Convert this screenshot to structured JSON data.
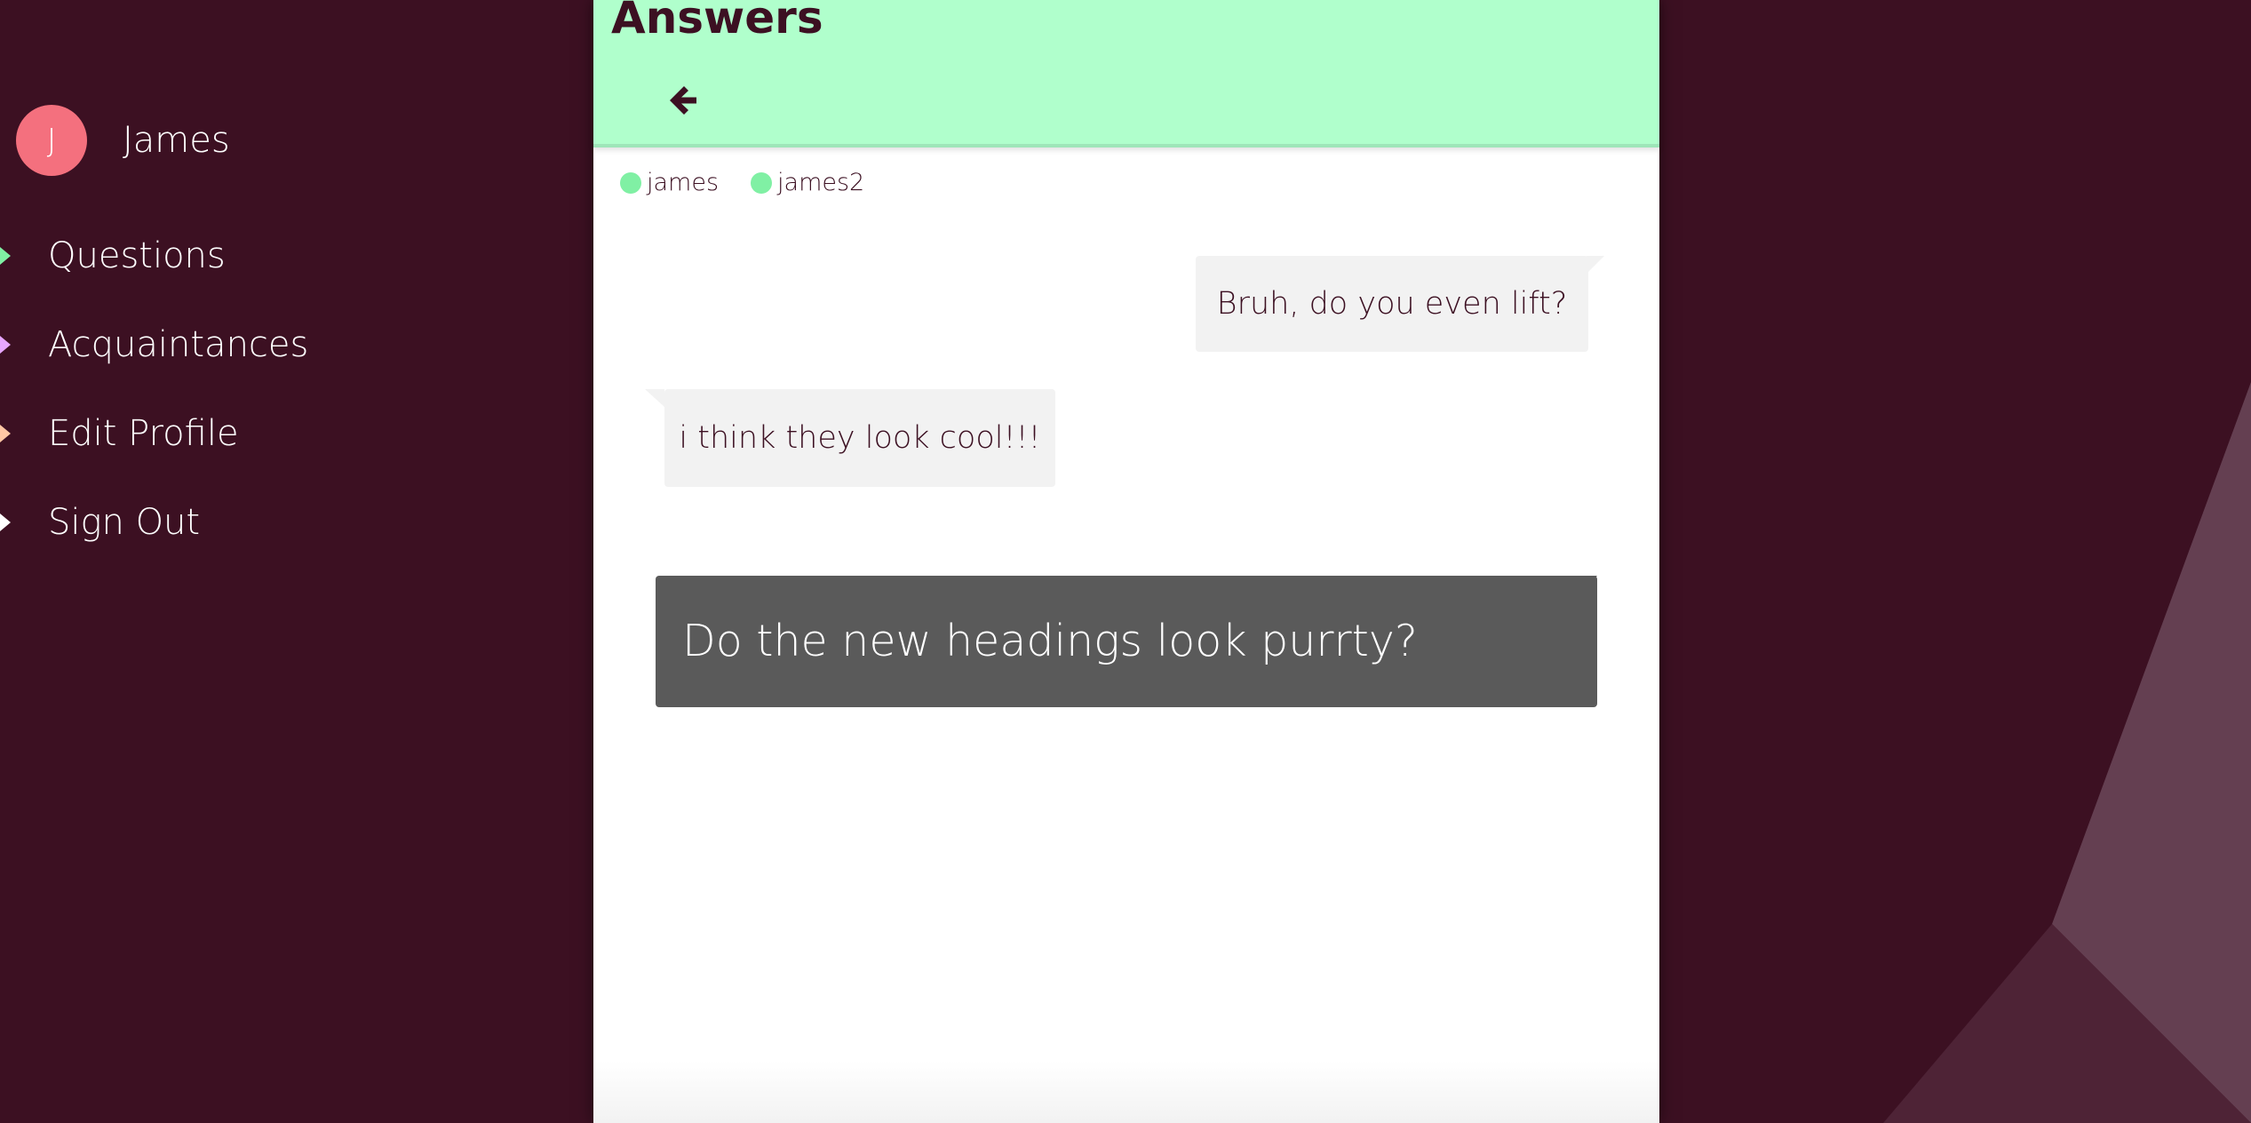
{
  "colors": {
    "background": "#3c1022",
    "header": "#b0ffcc",
    "avatar": "#f4707e",
    "online_dot": "#80f0a4",
    "bubble": "#f2f2f2",
    "question_card": "#5a5a5a"
  },
  "sidebar": {
    "user": {
      "initial": "J",
      "name": "James"
    },
    "items": [
      {
        "label": "Questions",
        "marker_color": "#80f0a4"
      },
      {
        "label": "Acquaintances",
        "marker_color": "#e7a6ff"
      },
      {
        "label": "Edit Profile",
        "marker_color": "#ffc7a4"
      },
      {
        "label": "Sign Out",
        "marker_color": "#ffffff"
      }
    ]
  },
  "header": {
    "title": "Answers",
    "back_icon": "arrow-left-icon"
  },
  "participants": [
    {
      "name": "james",
      "status": "online"
    },
    {
      "name": "james2",
      "status": "online"
    }
  ],
  "messages": [
    {
      "text": "Bruh, do you even lift?",
      "side": "right"
    },
    {
      "text": "i think they look cool!!!",
      "side": "left"
    }
  ],
  "question": {
    "text": "Do the new headings look purrty?"
  }
}
